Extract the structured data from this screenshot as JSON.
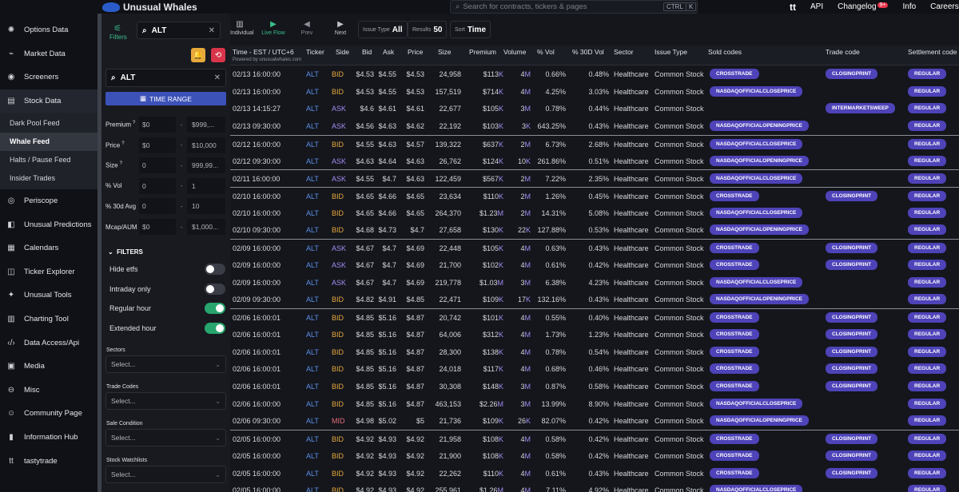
{
  "topbar": {
    "brand": "Unusual Whales",
    "search_placeholder": "Search for contracts, tickers & pages",
    "kbd1": "CTRL",
    "kbd2": "K",
    "tt": "tt",
    "links": [
      "API",
      "Changelog",
      "Info",
      "Careers"
    ],
    "changelog_badge": "9+"
  },
  "sidebar": {
    "items": [
      {
        "label": "Options Data",
        "icon": "✺"
      },
      {
        "label": "Market Data",
        "icon": "⌁"
      },
      {
        "label": "Screeners",
        "icon": "◉"
      },
      {
        "label": "Stock Data",
        "icon": "▤"
      }
    ],
    "subitems": [
      "Dark Pool Feed",
      "Whale Feed",
      "Halts / Pause Feed",
      "Insider Trades"
    ],
    "items2": [
      {
        "label": "Periscope",
        "icon": "◎"
      },
      {
        "label": "Unusual Predictions",
        "icon": "◧"
      },
      {
        "label": "Calendars",
        "icon": "▦"
      },
      {
        "label": "Ticker Explorer",
        "icon": "◫"
      },
      {
        "label": "Unusual Tools",
        "icon": "✦"
      },
      {
        "label": "Charting Tool",
        "icon": "▥"
      },
      {
        "label": "Data Access/Api",
        "icon": "‹/›"
      },
      {
        "label": "Media",
        "icon": "▣"
      },
      {
        "label": "Misc",
        "icon": "⊖"
      },
      {
        "label": "Community Page",
        "icon": "☺"
      },
      {
        "label": "Information Hub",
        "icon": "▮"
      },
      {
        "label": "tastytrade",
        "icon": "tt"
      }
    ]
  },
  "filters": {
    "filters_tab": "Filters",
    "top_search": "ALT",
    "ticker_search": "ALT",
    "time_range": "TIME RANGE",
    "ranges": [
      {
        "label": "Premium",
        "help": "?",
        "min": "$0",
        "max": "$999,..."
      },
      {
        "label": "Price",
        "help": "?",
        "min": "$0",
        "max": "$10,000"
      },
      {
        "label": "Size",
        "help": "?",
        "min": "0",
        "max": "999,99..."
      },
      {
        "label": "% Vol",
        "help": "",
        "min": "0",
        "max": "1"
      },
      {
        "label": "% 30d Avg",
        "help": "",
        "min": "0",
        "max": "10"
      },
      {
        "label": "Mcap/AUM",
        "help": "",
        "min": "$0",
        "max": "$1,000..."
      }
    ],
    "filters_header": "FILTERS",
    "toggles": [
      {
        "label": "Hide etfs",
        "on": false
      },
      {
        "label": "Intraday only",
        "on": false
      },
      {
        "label": "Regular hour",
        "on": true
      },
      {
        "label": "Extended hour",
        "on": true
      }
    ],
    "groups": [
      {
        "label": "Sectors",
        "placeholder": "Select..."
      },
      {
        "label": "Trade Codes",
        "placeholder": "Select..."
      },
      {
        "label": "Sale Condition",
        "placeholder": "Select..."
      },
      {
        "label": "Stock Watchlists",
        "placeholder": "Select..."
      }
    ]
  },
  "toolbar": {
    "individual": "Individual",
    "live_flow": "Live Flow",
    "prev": "Prev",
    "next": "Next",
    "issue_type_label": "Issue Type",
    "issue_type_value": "All",
    "results_label": "Results",
    "results_value": "50",
    "sort_label": "Sort",
    "sort_value": "Time"
  },
  "table": {
    "columns": [
      "Time - EST / UTC+6",
      "Ticker",
      "Side",
      "Bid",
      "Ask",
      "Price",
      "Size",
      "Premium",
      "Volume",
      "% Vol",
      "% 30D Vol",
      "Sector",
      "Issue Type",
      "Sold codes",
      "Trade code",
      "Settlement code"
    ],
    "powered": "Powered by unusualwhales.com",
    "rows": [
      {
        "time": "02/13 16:00:00",
        "ticker": "ALT",
        "side": "BID",
        "bid": "$4.53",
        "ask": "$4.55",
        "price": "$4.53",
        "size": "24,958",
        "premium": "$113",
        "pu": "K",
        "volume": "4",
        "vu": "M",
        "pvol": "0.66%",
        "p30": "0.48%",
        "sector": "Healthcare",
        "issue": "Common Stock",
        "sold": "CROSSTRADE",
        "trade": "CLOSINGPRINT",
        "settle": "REGULAR",
        "sep": false
      },
      {
        "time": "02/13 16:00:00",
        "ticker": "ALT",
        "side": "BID",
        "bid": "$4.53",
        "ask": "$4.55",
        "price": "$4.53",
        "size": "157,519",
        "premium": "$714",
        "pu": "K",
        "volume": "4",
        "vu": "M",
        "pvol": "4.25%",
        "p30": "3.03%",
        "sector": "Healthcare",
        "issue": "Common Stock",
        "sold": "NASDAQOFFICIALCLOSEPRICE",
        "trade": "",
        "settle": "REGULAR",
        "sep": false
      },
      {
        "time": "02/13 14:15:27",
        "ticker": "ALT",
        "side": "ASK",
        "bid": "$4.6",
        "ask": "$4.61",
        "price": "$4.61",
        "size": "22,677",
        "premium": "$105",
        "pu": "K",
        "volume": "3",
        "vu": "M",
        "pvol": "0.78%",
        "p30": "0.44%",
        "sector": "Healthcare",
        "issue": "Common Stock",
        "sold": "",
        "trade": "INTERMARKETSWEEP",
        "settle": "REGULAR",
        "sep": false
      },
      {
        "time": "02/13 09:30:00",
        "ticker": "ALT",
        "side": "ASK",
        "bid": "$4.56",
        "ask": "$4.63",
        "price": "$4.62",
        "size": "22,192",
        "premium": "$103",
        "pu": "K",
        "volume": "3",
        "vu": "K",
        "pvol": "643.25%",
        "p30": "0.43%",
        "sector": "Healthcare",
        "issue": "Common Stock",
        "sold": "NASDAQOFFICIALOPENINGPRICE",
        "trade": "",
        "settle": "REGULAR",
        "sep": false
      },
      {
        "time": "02/12 16:00:00",
        "ticker": "ALT",
        "side": "BID",
        "bid": "$4.55",
        "ask": "$4.63",
        "price": "$4.57",
        "size": "139,322",
        "premium": "$637",
        "pu": "K",
        "volume": "2",
        "vu": "M",
        "pvol": "6.73%",
        "p30": "2.68%",
        "sector": "Healthcare",
        "issue": "Common Stock",
        "sold": "NASDAQOFFICIALCLOSEPRICE",
        "trade": "",
        "settle": "REGULAR",
        "sep": true
      },
      {
        "time": "02/12 09:30:00",
        "ticker": "ALT",
        "side": "ASK",
        "bid": "$4.63",
        "ask": "$4.64",
        "price": "$4.63",
        "size": "26,762",
        "premium": "$124",
        "pu": "K",
        "volume": "10",
        "vu": "K",
        "pvol": "261.86%",
        "p30": "0.51%",
        "sector": "Healthcare",
        "issue": "Common Stock",
        "sold": "NASDAQOFFICIALOPENINGPRICE",
        "trade": "",
        "settle": "REGULAR",
        "sep": false
      },
      {
        "time": "02/11 16:00:00",
        "ticker": "ALT",
        "side": "ASK",
        "bid": "$4.55",
        "ask": "$4.7",
        "price": "$4.63",
        "size": "122,459",
        "premium": "$567",
        "pu": "K",
        "volume": "2",
        "vu": "M",
        "pvol": "7.22%",
        "p30": "2.35%",
        "sector": "Healthcare",
        "issue": "Common Stock",
        "sold": "NASDAQOFFICIALCLOSEPRICE",
        "trade": "",
        "settle": "REGULAR",
        "sep": true
      },
      {
        "time": "02/10 16:00:00",
        "ticker": "ALT",
        "side": "BID",
        "bid": "$4.65",
        "ask": "$4.66",
        "price": "$4.65",
        "size": "23,634",
        "premium": "$110",
        "pu": "K",
        "volume": "2",
        "vu": "M",
        "pvol": "1.26%",
        "p30": "0.45%",
        "sector": "Healthcare",
        "issue": "Common Stock",
        "sold": "CROSSTRADE",
        "trade": "CLOSINGPRINT",
        "settle": "REGULAR",
        "sep": true
      },
      {
        "time": "02/10 16:00:00",
        "ticker": "ALT",
        "side": "BID",
        "bid": "$4.65",
        "ask": "$4.66",
        "price": "$4.65",
        "size": "264,370",
        "premium": "$1.23",
        "pu": "M",
        "volume": "2",
        "vu": "M",
        "pvol": "14.31%",
        "p30": "5.08%",
        "sector": "Healthcare",
        "issue": "Common Stock",
        "sold": "NASDAQOFFICIALCLOSEPRICE",
        "trade": "",
        "settle": "REGULAR",
        "sep": false
      },
      {
        "time": "02/10 09:30:00",
        "ticker": "ALT",
        "side": "BID",
        "bid": "$4.68",
        "ask": "$4.73",
        "price": "$4.7",
        "size": "27,658",
        "premium": "$130",
        "pu": "K",
        "volume": "22",
        "vu": "K",
        "pvol": "127.88%",
        "p30": "0.53%",
        "sector": "Healthcare",
        "issue": "Common Stock",
        "sold": "NASDAQOFFICIALOPENINGPRICE",
        "trade": "",
        "settle": "REGULAR",
        "sep": false
      },
      {
        "time": "02/09 16:00:00",
        "ticker": "ALT",
        "side": "ASK",
        "bid": "$4.67",
        "ask": "$4.7",
        "price": "$4.69",
        "size": "22,448",
        "premium": "$105",
        "pu": "K",
        "volume": "4",
        "vu": "M",
        "pvol": "0.63%",
        "p30": "0.43%",
        "sector": "Healthcare",
        "issue": "Common Stock",
        "sold": "CROSSTRADE",
        "trade": "CLOSINGPRINT",
        "settle": "REGULAR",
        "sep": true
      },
      {
        "time": "02/09 16:00:00",
        "ticker": "ALT",
        "side": "ASK",
        "bid": "$4.67",
        "ask": "$4.7",
        "price": "$4.69",
        "size": "21,700",
        "premium": "$102",
        "pu": "K",
        "volume": "4",
        "vu": "M",
        "pvol": "0.61%",
        "p30": "0.42%",
        "sector": "Healthcare",
        "issue": "Common Stock",
        "sold": "CROSSTRADE",
        "trade": "CLOSINGPRINT",
        "settle": "REGULAR",
        "sep": false
      },
      {
        "time": "02/09 16:00:00",
        "ticker": "ALT",
        "side": "ASK",
        "bid": "$4.67",
        "ask": "$4.7",
        "price": "$4.69",
        "size": "219,778",
        "premium": "$1.03",
        "pu": "M",
        "volume": "3",
        "vu": "M",
        "pvol": "6.38%",
        "p30": "4.23%",
        "sector": "Healthcare",
        "issue": "Common Stock",
        "sold": "NASDAQOFFICIALCLOSEPRICE",
        "trade": "",
        "settle": "REGULAR",
        "sep": false
      },
      {
        "time": "02/09 09:30:00",
        "ticker": "ALT",
        "side": "BID",
        "bid": "$4.82",
        "ask": "$4.91",
        "price": "$4.85",
        "size": "22,471",
        "premium": "$109",
        "pu": "K",
        "volume": "17",
        "vu": "K",
        "pvol": "132.16%",
        "p30": "0.43%",
        "sector": "Healthcare",
        "issue": "Common Stock",
        "sold": "NASDAQOFFICIALOPENINGPRICE",
        "trade": "",
        "settle": "REGULAR",
        "sep": false
      },
      {
        "time": "02/06 16:00:01",
        "ticker": "ALT",
        "side": "BID",
        "bid": "$4.85",
        "ask": "$5.16",
        "price": "$4.87",
        "size": "20,742",
        "premium": "$101",
        "pu": "K",
        "volume": "4",
        "vu": "M",
        "pvol": "0.55%",
        "p30": "0.40%",
        "sector": "Healthcare",
        "issue": "Common Stock",
        "sold": "CROSSTRADE",
        "trade": "CLOSINGPRINT",
        "settle": "REGULAR",
        "sep": true
      },
      {
        "time": "02/06 16:00:01",
        "ticker": "ALT",
        "side": "BID",
        "bid": "$4.85",
        "ask": "$5.16",
        "price": "$4.87",
        "size": "64,006",
        "premium": "$312",
        "pu": "K",
        "volume": "4",
        "vu": "M",
        "pvol": "1.73%",
        "p30": "1.23%",
        "sector": "Healthcare",
        "issue": "Common Stock",
        "sold": "CROSSTRADE",
        "trade": "CLOSINGPRINT",
        "settle": "REGULAR",
        "sep": false
      },
      {
        "time": "02/06 16:00:01",
        "ticker": "ALT",
        "side": "BID",
        "bid": "$4.85",
        "ask": "$5.16",
        "price": "$4.87",
        "size": "28,300",
        "premium": "$138",
        "pu": "K",
        "volume": "4",
        "vu": "M",
        "pvol": "0.78%",
        "p30": "0.54%",
        "sector": "Healthcare",
        "issue": "Common Stock",
        "sold": "CROSSTRADE",
        "trade": "CLOSINGPRINT",
        "settle": "REGULAR",
        "sep": false
      },
      {
        "time": "02/06 16:00:01",
        "ticker": "ALT",
        "side": "BID",
        "bid": "$4.85",
        "ask": "$5.16",
        "price": "$4.87",
        "size": "24,018",
        "premium": "$117",
        "pu": "K",
        "volume": "4",
        "vu": "M",
        "pvol": "0.68%",
        "p30": "0.46%",
        "sector": "Healthcare",
        "issue": "Common Stock",
        "sold": "CROSSTRADE",
        "trade": "CLOSINGPRINT",
        "settle": "REGULAR",
        "sep": false
      },
      {
        "time": "02/06 16:00:01",
        "ticker": "ALT",
        "side": "BID",
        "bid": "$4.85",
        "ask": "$5.16",
        "price": "$4.87",
        "size": "30,308",
        "premium": "$148",
        "pu": "K",
        "volume": "3",
        "vu": "M",
        "pvol": "0.87%",
        "p30": "0.58%",
        "sector": "Healthcare",
        "issue": "Common Stock",
        "sold": "CROSSTRADE",
        "trade": "CLOSINGPRINT",
        "settle": "REGULAR",
        "sep": false
      },
      {
        "time": "02/06 16:00:00",
        "ticker": "ALT",
        "side": "BID",
        "bid": "$4.85",
        "ask": "$5.16",
        "price": "$4.87",
        "size": "463,153",
        "premium": "$2.26",
        "pu": "M",
        "volume": "3",
        "vu": "M",
        "pvol": "13.99%",
        "p30": "8.90%",
        "sector": "Healthcare",
        "issue": "Common Stock",
        "sold": "NASDAQOFFICIALCLOSEPRICE",
        "trade": "",
        "settle": "REGULAR",
        "sep": false
      },
      {
        "time": "02/06 09:30:00",
        "ticker": "ALT",
        "side": "MID",
        "bid": "$4.98",
        "ask": "$5.02",
        "price": "$5",
        "size": "21,736",
        "premium": "$109",
        "pu": "K",
        "volume": "26",
        "vu": "K",
        "pvol": "82.07%",
        "p30": "0.42%",
        "sector": "Healthcare",
        "issue": "Common Stock",
        "sold": "NASDAQOFFICIALOPENINGPRICE",
        "trade": "",
        "settle": "REGULAR",
        "sep": false
      },
      {
        "time": "02/05 16:00:00",
        "ticker": "ALT",
        "side": "BID",
        "bid": "$4.92",
        "ask": "$4.93",
        "price": "$4.92",
        "size": "21,958",
        "premium": "$108",
        "pu": "K",
        "volume": "4",
        "vu": "M",
        "pvol": "0.58%",
        "p30": "0.42%",
        "sector": "Healthcare",
        "issue": "Common Stock",
        "sold": "CROSSTRADE",
        "trade": "CLOSINGPRINT",
        "settle": "REGULAR",
        "sep": true
      },
      {
        "time": "02/05 16:00:00",
        "ticker": "ALT",
        "side": "BID",
        "bid": "$4.92",
        "ask": "$4.93",
        "price": "$4.92",
        "size": "21,900",
        "premium": "$108",
        "pu": "K",
        "volume": "4",
        "vu": "M",
        "pvol": "0.58%",
        "p30": "0.42%",
        "sector": "Healthcare",
        "issue": "Common Stock",
        "sold": "CROSSTRADE",
        "trade": "CLOSINGPRINT",
        "settle": "REGULAR",
        "sep": false
      },
      {
        "time": "02/05 16:00:00",
        "ticker": "ALT",
        "side": "BID",
        "bid": "$4.92",
        "ask": "$4.93",
        "price": "$4.92",
        "size": "22,262",
        "premium": "$110",
        "pu": "K",
        "volume": "4",
        "vu": "M",
        "pvol": "0.61%",
        "p30": "0.43%",
        "sector": "Healthcare",
        "issue": "Common Stock",
        "sold": "CROSSTRADE",
        "trade": "CLOSINGPRINT",
        "settle": "REGULAR",
        "sep": false
      },
      {
        "time": "02/05 16:00:00",
        "ticker": "ALT",
        "side": "BID",
        "bid": "$4.92",
        "ask": "$4.93",
        "price": "$4.92",
        "size": "255,961",
        "premium": "$1.26",
        "pu": "M",
        "volume": "4",
        "vu": "M",
        "pvol": "7.11%",
        "p30": "4.92%",
        "sector": "Healthcare",
        "issue": "Common Stock",
        "sold": "NASDAQOFFICIALCLOSEPRICE",
        "trade": "",
        "settle": "REGULAR",
        "sep": false
      }
    ]
  }
}
